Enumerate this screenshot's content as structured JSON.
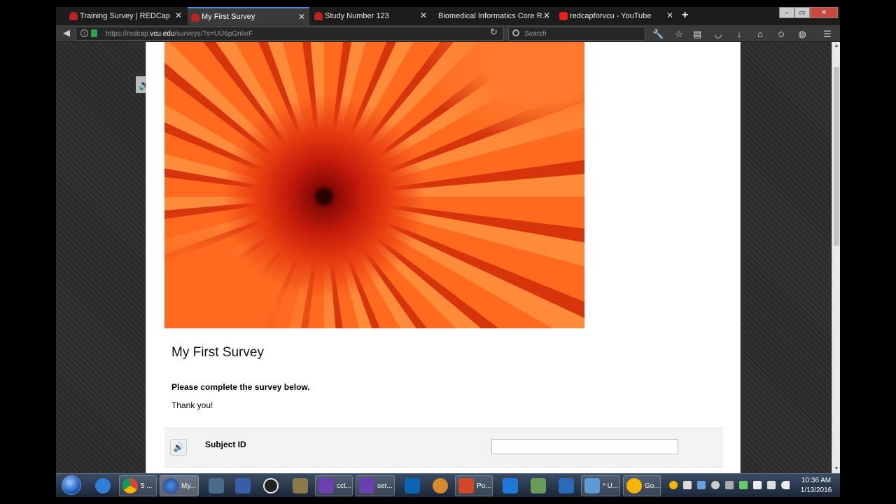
{
  "browser": {
    "tabs": [
      {
        "label": "Training Survey | REDCap",
        "active": false
      },
      {
        "label": "My First Survey",
        "active": true
      },
      {
        "label": "Study Number 123",
        "active": false
      },
      {
        "label": "Biomedical Informatics Core R...",
        "active": false
      },
      {
        "label": "redcapforvcu - YouTube",
        "active": false
      }
    ],
    "new_tab": "+",
    "url_prefix": "https://redcap.",
    "url_host": "vcu.edu",
    "url_path": "/surveys/?s=UU6pGnlxrF",
    "search_placeholder": "Search",
    "window_controls": {
      "minimize": "–",
      "restore": "▭",
      "close": "✕"
    }
  },
  "page": {
    "title": "My First Survey",
    "instructions": "Please complete the survey below.",
    "thanks": "Thank you!",
    "fields": [
      {
        "label": "Subject ID",
        "value": ""
      }
    ]
  },
  "taskbar": {
    "items": [
      {
        "label": "5 ...",
        "icon": "chrome-icon",
        "color": "#e0a020"
      },
      {
        "label": "My...",
        "icon": "firefox-icon",
        "color": "#2a5fbf"
      },
      {
        "label": "cct...",
        "icon": "visual-studio-icon",
        "color": "#6a3fb0"
      },
      {
        "label": "ser...",
        "icon": "visual-studio-icon",
        "color": "#6a3fb0"
      },
      {
        "label": "Po...",
        "icon": "powerpoint-icon",
        "color": "#d24726"
      },
      {
        "label": "* U...",
        "icon": "notepad-icon",
        "color": "#5b9bd5"
      },
      {
        "label": "Go...",
        "icon": "google-icon",
        "color": "#f4b400"
      }
    ],
    "clock_time": "10:36 AM",
    "clock_date": "1/13/2016"
  }
}
